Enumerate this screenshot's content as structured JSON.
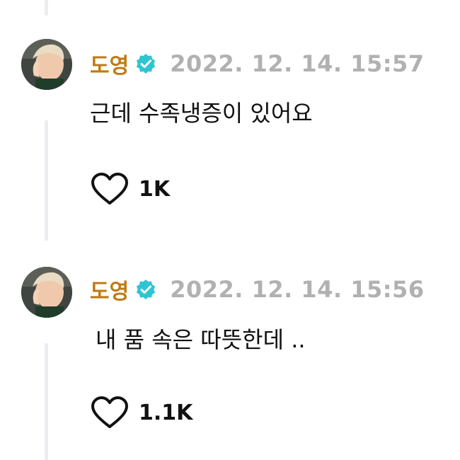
{
  "comments": [
    {
      "author": "도영",
      "timestamp": "2022. 12. 14. 15:57",
      "text": "근데 수족냉증이 있어요",
      "likes": "1K"
    },
    {
      "author": "도영",
      "timestamp": "2022. 12. 14. 15:56",
      "text": "내 품 속은 따뜻한데 ..",
      "likes": "1.1K"
    }
  ],
  "colors": {
    "author": "#c07a12",
    "verified_badge": "#2ec5d3",
    "timestamp": "#b1b1b1",
    "thread_line": "#ececf1"
  },
  "icons": {
    "verified": "verified-badge-icon",
    "like": "heart-icon"
  }
}
